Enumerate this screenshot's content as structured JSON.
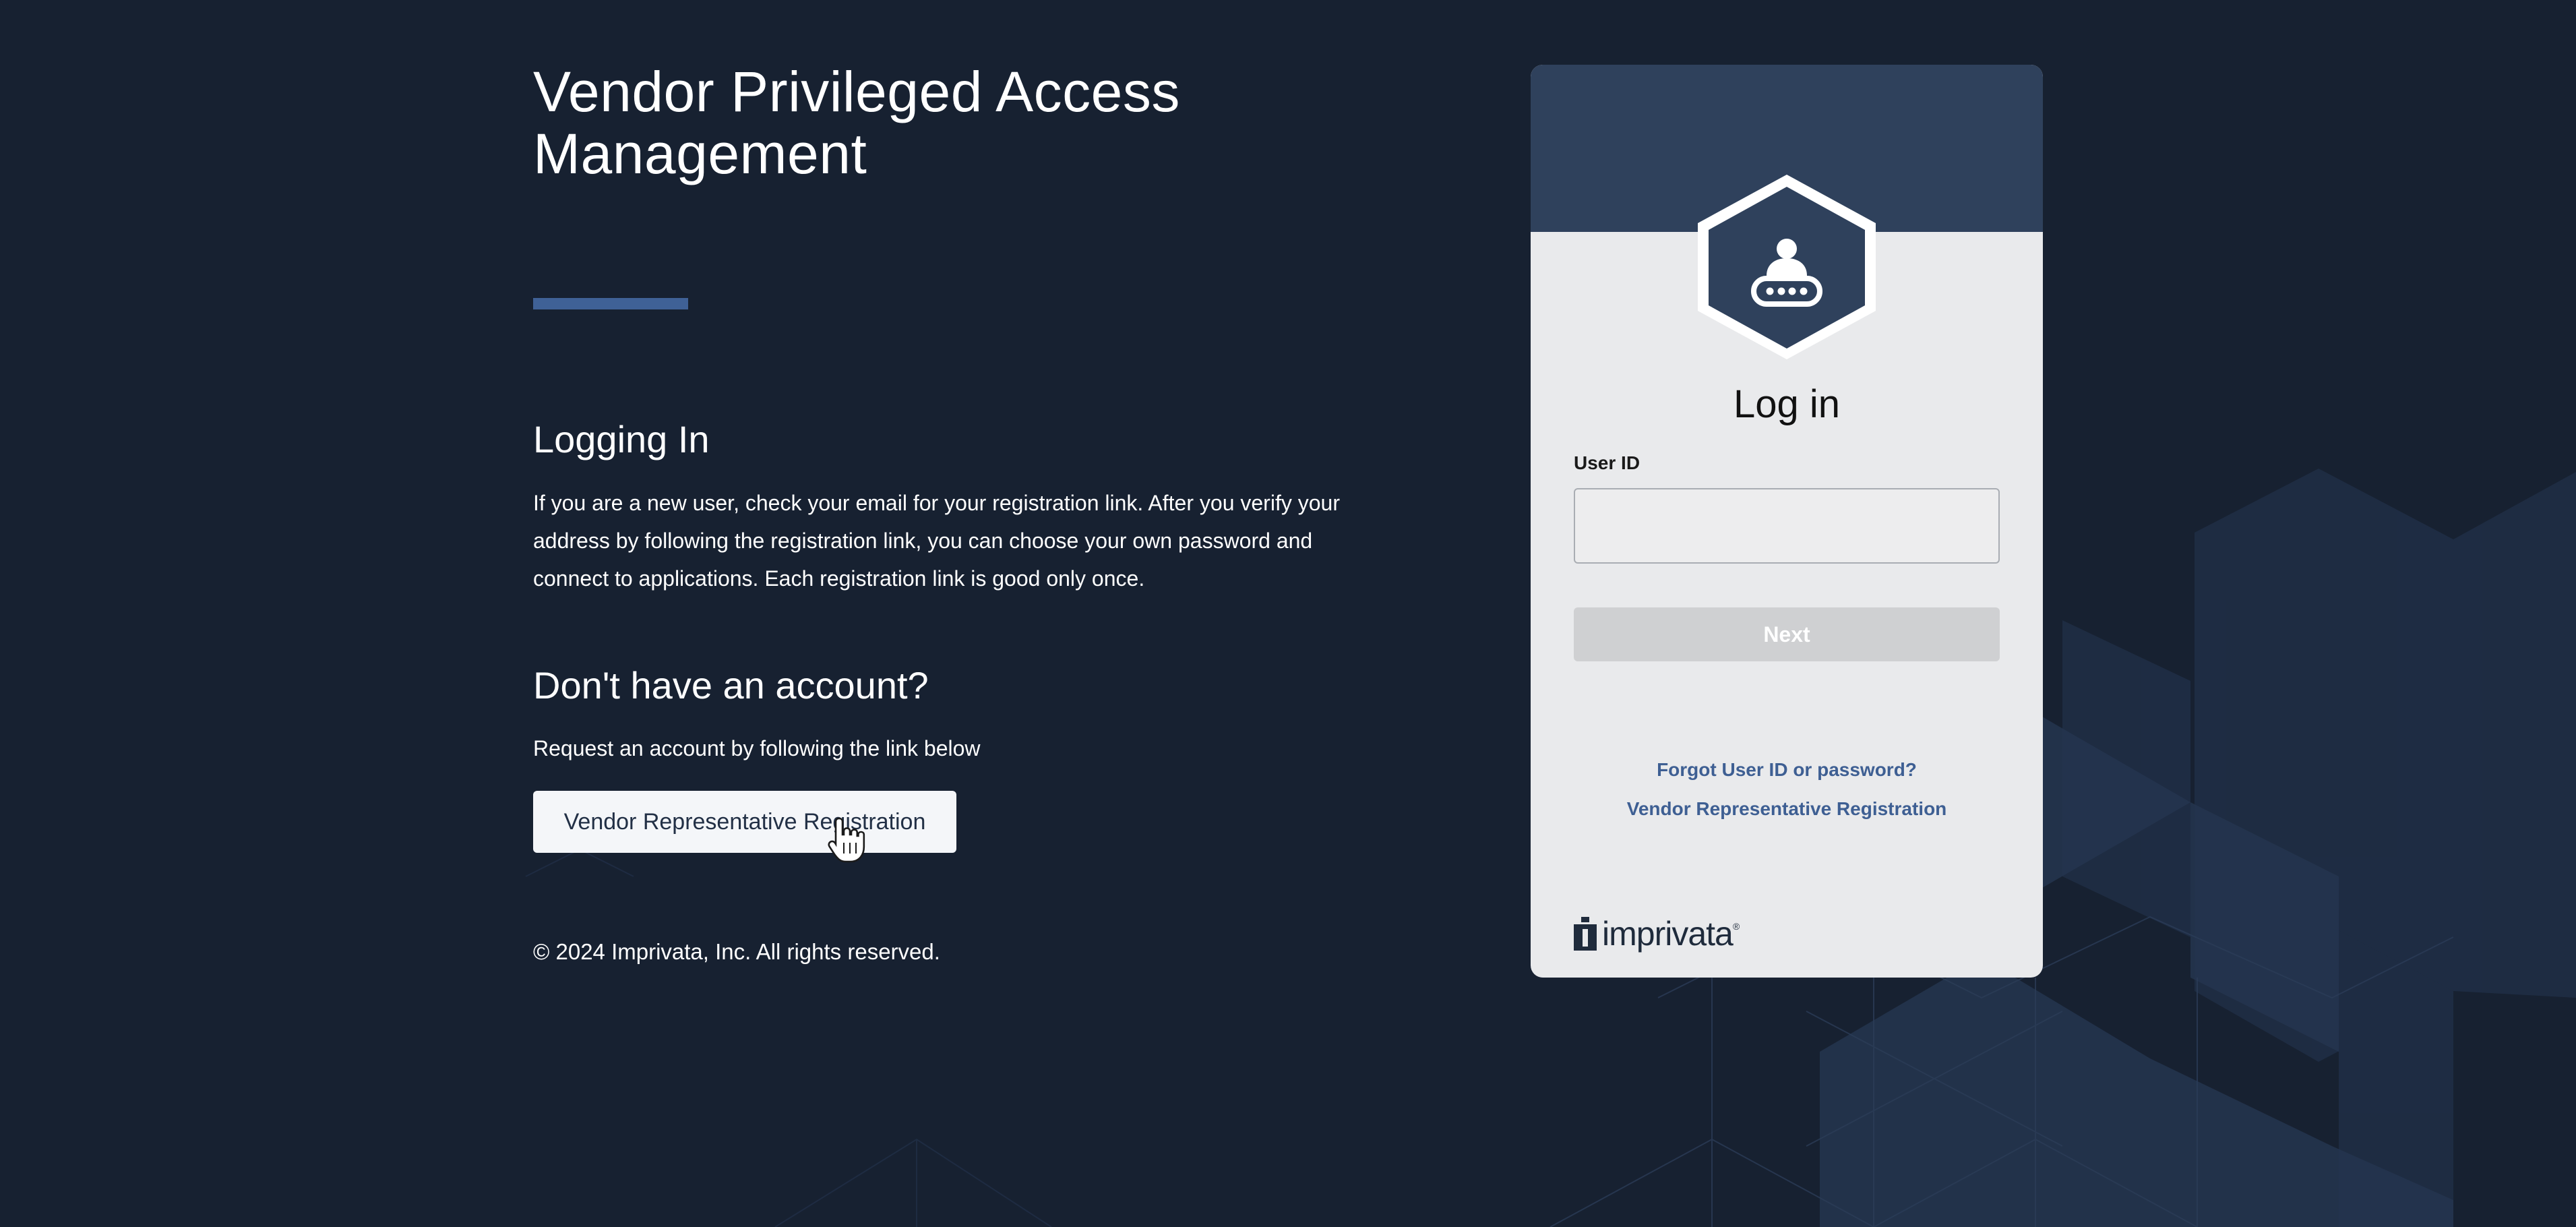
{
  "colors": {
    "background": "#172131",
    "accent_bar": "#3f6196",
    "card_background": "#e9eaec",
    "card_header": "#2f415c",
    "link": "#3e5f93",
    "next_button_disabled": "#cfd0d2"
  },
  "left_panel": {
    "title": "Vendor Privileged Access Management",
    "logging_in": {
      "heading": "Logging In",
      "paragraph": "If you are a new user, check your email for your registration link. After you verify your address by following the registration link, you can choose your own password and connect to applications. Each registration link is good only once."
    },
    "no_account": {
      "heading": "Don't have an account?",
      "paragraph": "Request an account by following the link below",
      "button_label": "Vendor Representative Registration"
    },
    "copyright": "© 2024 Imprivata, Inc. All rights reserved."
  },
  "login_card": {
    "title": "Log in",
    "user_id_label": "User ID",
    "user_id_value": "",
    "user_id_placeholder": "",
    "next_label": "Next",
    "forgot_link": "Forgot User ID or password?",
    "registration_link": "Vendor Representative Registration",
    "brand_name": "imprivata",
    "brand_tm": "®",
    "hex_icon": "vendor-user-password-icon"
  },
  "cursor": "hand-pointer-icon"
}
